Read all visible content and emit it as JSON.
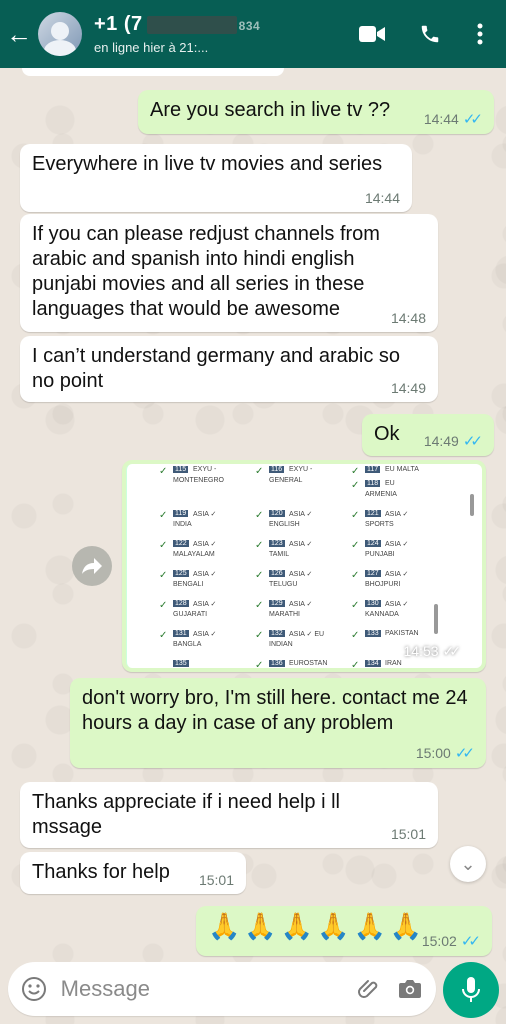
{
  "header": {
    "back_glyph": "←",
    "contact_name": "+1 (7",
    "contact_name_tail": "834",
    "status": "en ligne hier à 21:..."
  },
  "messages": [
    {
      "dir": "out",
      "text": "Are you search in live tv ??",
      "time": "14:44",
      "read": true
    },
    {
      "dir": "in",
      "text": "Everywhere in live tv movies and series",
      "time": "14:44"
    },
    {
      "dir": "in",
      "text": "If you can please redjust channels from arabic and spanish into hindi english punjabi movies and all series in these languages that would be awesome",
      "time": "14:48"
    },
    {
      "dir": "in",
      "text": "I can’t understand germany and arabic so no point",
      "time": "14:49"
    },
    {
      "dir": "out",
      "text": "Ok",
      "time": "14:49",
      "read": true
    },
    {
      "dir": "out",
      "type": "image",
      "time": "14:53",
      "read": true
    },
    {
      "dir": "out",
      "text": "don't worry bro, I'm still here. contact me 24 hours a day in case of any problem",
      "time": "15:00",
      "read": true
    },
    {
      "dir": "in",
      "text": "Thanks appreciate if i need help i ll mssage",
      "time": "15:01"
    },
    {
      "dir": "in",
      "text": "Thanks for help",
      "time": "15:01"
    },
    {
      "dir": "out",
      "text": "🙏🙏🙏🙏🙏🙏",
      "time": "15:02",
      "read": true
    }
  ],
  "image_cells": [
    {
      "chk": "✓",
      "num": "115",
      "cat": "EXYU -",
      "sub": "MONTENEGRO"
    },
    {
      "chk": "✓",
      "num": "116",
      "cat": "EXYU -",
      "sub": "GENERAL"
    },
    {
      "chk": "✓",
      "num": "117",
      "cat": "EU MALTA",
      "sub": ""
    },
    {
      "chk": "✓",
      "num": "118",
      "cat": "EU",
      "sub": "ARMENIA"
    },
    {
      "chk": "✓",
      "num": "119",
      "cat": "ASIA ✓",
      "sub": "INDIA"
    },
    {
      "chk": "✓",
      "num": "120",
      "cat": "ASIA ✓",
      "sub": "ENGLISH"
    },
    {
      "chk": "✓",
      "num": "121",
      "cat": "ASIA ✓",
      "sub": "SPORTS"
    },
    {
      "chk": "✓",
      "num": "122",
      "cat": "ASIA ✓",
      "sub": "MALAYALAM"
    },
    {
      "chk": "✓",
      "num": "123",
      "cat": "ASIA ✓",
      "sub": "TAMIL"
    },
    {
      "chk": "✓",
      "num": "124",
      "cat": "ASIA ✓",
      "sub": "PUNJABI"
    },
    {
      "chk": "✓",
      "num": "125",
      "cat": "ASIA ✓",
      "sub": "BENGALI"
    },
    {
      "chk": "✓",
      "num": "126",
      "cat": "ASIA ✓",
      "sub": "TELUGU"
    },
    {
      "chk": "✓",
      "num": "127",
      "cat": "ASIA ✓",
      "sub": "BHOJPURI"
    },
    {
      "chk": "✓",
      "num": "128",
      "cat": "ASIA ✓",
      "sub": "GUJARATI"
    },
    {
      "chk": "✓",
      "num": "129",
      "cat": "ASIA ✓",
      "sub": "MARATHI"
    },
    {
      "chk": "✓",
      "num": "130",
      "cat": "ASIA ✓",
      "sub": "KANNADA"
    },
    {
      "chk": "✓",
      "num": "131",
      "cat": "ASIA ✓",
      "sub": "BANGLA"
    },
    {
      "chk": "✓",
      "num": "132",
      "cat": "ASIA ✓ EU",
      "sub": "INDIAN"
    },
    {
      "chk": "✓",
      "num": "133",
      "cat": "PAKISTAN",
      "sub": ""
    },
    {
      "chk": "✓",
      "num": "134",
      "cat": "IRAN",
      "sub": ""
    },
    {
      "chk": "",
      "num": "135",
      "cat": "",
      "sub": ""
    },
    {
      "chk": "✓",
      "num": "136",
      "cat": "EUROSTAN",
      "sub": ""
    }
  ],
  "composer": {
    "placeholder": "Message"
  },
  "icons": {
    "video": "video-call-icon",
    "call": "phone-icon",
    "menu": "more-vert-icon",
    "emoji": "emoji-icon",
    "attach": "paperclip-icon",
    "camera": "camera-icon",
    "mic": "microphone-icon",
    "forward": "forward-icon",
    "scroll": "chevron-down-icon"
  },
  "colors": {
    "header": "#075e54",
    "outgoing": "#dcf8c6",
    "incoming": "#ffffff",
    "read_ticks": "#34b7f1",
    "mic": "#00a884"
  }
}
